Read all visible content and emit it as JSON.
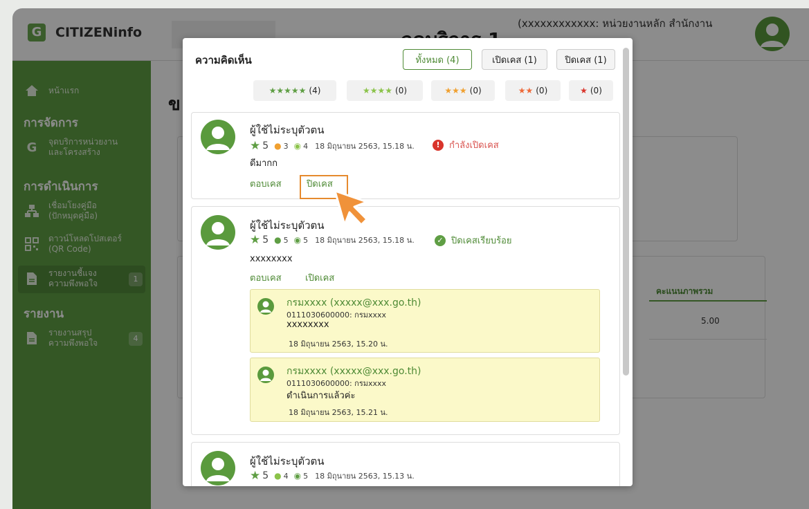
{
  "app": {
    "logo_letter": "G",
    "title": "CITIZENinfo"
  },
  "header": {
    "page_heading": "จุดบริการ 1",
    "org": "(xxxxxxxxxxxx: หน่วยงานหลัก สำนักงาน"
  },
  "sidebar": {
    "home": "หน้าแรก",
    "section_manage": "การจัดการ",
    "service_point": "จุดบริการหน่วยงาน\nและโครงสร้าง",
    "section_ops": "การดำเนินการ",
    "link_manual": "เชื่อมโยงคู่มือ\n(ปักหมุดคู่มือ)",
    "download_poster": "ดาวน์โหลดโปสเตอร์\n(QR Code)",
    "report_satisfaction": "รายงานชี้แจง\nความพึงพอใจ",
    "report_satisfaction_badge": "1",
    "section_report": "รายงาน",
    "summary_report": "รายงานสรุป\nความพึงพอใจ",
    "summary_report_badge": "4"
  },
  "background": {
    "title_char": "ข",
    "col_header": "คะแนนภาพรวม",
    "col_value": "5.00"
  },
  "modal": {
    "title": "ความคิดเห็น",
    "filters": {
      "all": "ทั้งหมด (4)",
      "open": "เปิดเคส (1)",
      "closed": "ปิดเคส (1)"
    },
    "star_filters": [
      {
        "stars": "★★★★★",
        "count": "(4)",
        "color": "#5f9e44"
      },
      {
        "stars": "★★★★",
        "count": "(0)",
        "color": "#8bc34a"
      },
      {
        "stars": "★★★",
        "count": "(0)",
        "color": "#f0a030"
      },
      {
        "stars": "★★",
        "count": "(0)",
        "color": "#ee6a3a"
      },
      {
        "stars": "★",
        "count": "(0)",
        "color": "#d9342b"
      }
    ],
    "comments": [
      {
        "name": "ผู้ใช้ไม่ระบุตัวตน",
        "star_score": "5",
        "person_score": "3",
        "speed_score": "4",
        "date": "18 มิถุนายน 2563, 15.18 น.",
        "status": "กำลังเปิดเคส",
        "text": "ดีมากก",
        "action_reply": "ตอบเคส",
        "action_toggle": "ปิดเคส"
      },
      {
        "name": "ผู้ใช้ไม่ระบุตัวตน",
        "star_score": "5",
        "person_score": "5",
        "speed_score": "5",
        "date": "18 มิถุนายน 2563, 15.18 น.",
        "status": "ปิดเคสเรียบร้อย",
        "text": "xxxxxxxx",
        "action_reply": "ตอบเคส",
        "action_toggle": "เปิดเคส",
        "replies": [
          {
            "name": "กรมxxxx (xxxxx@xxx.go.th)",
            "org": "0111030600000: กรมxxxx",
            "text": "xxxxxxxx",
            "date": "18 มิถุนายน 2563, 15.20 น."
          },
          {
            "name": "กรมxxxx (xxxxx@xxx.go.th)",
            "org": "0111030600000: กรมxxxx",
            "text": "ดำเนินการแล้วค่ะ",
            "date": "18 มิถุนายน 2563, 15.21 น."
          }
        ]
      },
      {
        "name": "ผู้ใช้ไม่ระบุตัวตน",
        "star_score": "5",
        "person_score": "4",
        "speed_score": "5",
        "date": "18 มิถุนายน 2563, 15.13 น."
      }
    ]
  },
  "colors": {
    "brand_green": "#5f9e44",
    "accent_orange": "#e68a2e",
    "danger_red": "#d9534f"
  }
}
